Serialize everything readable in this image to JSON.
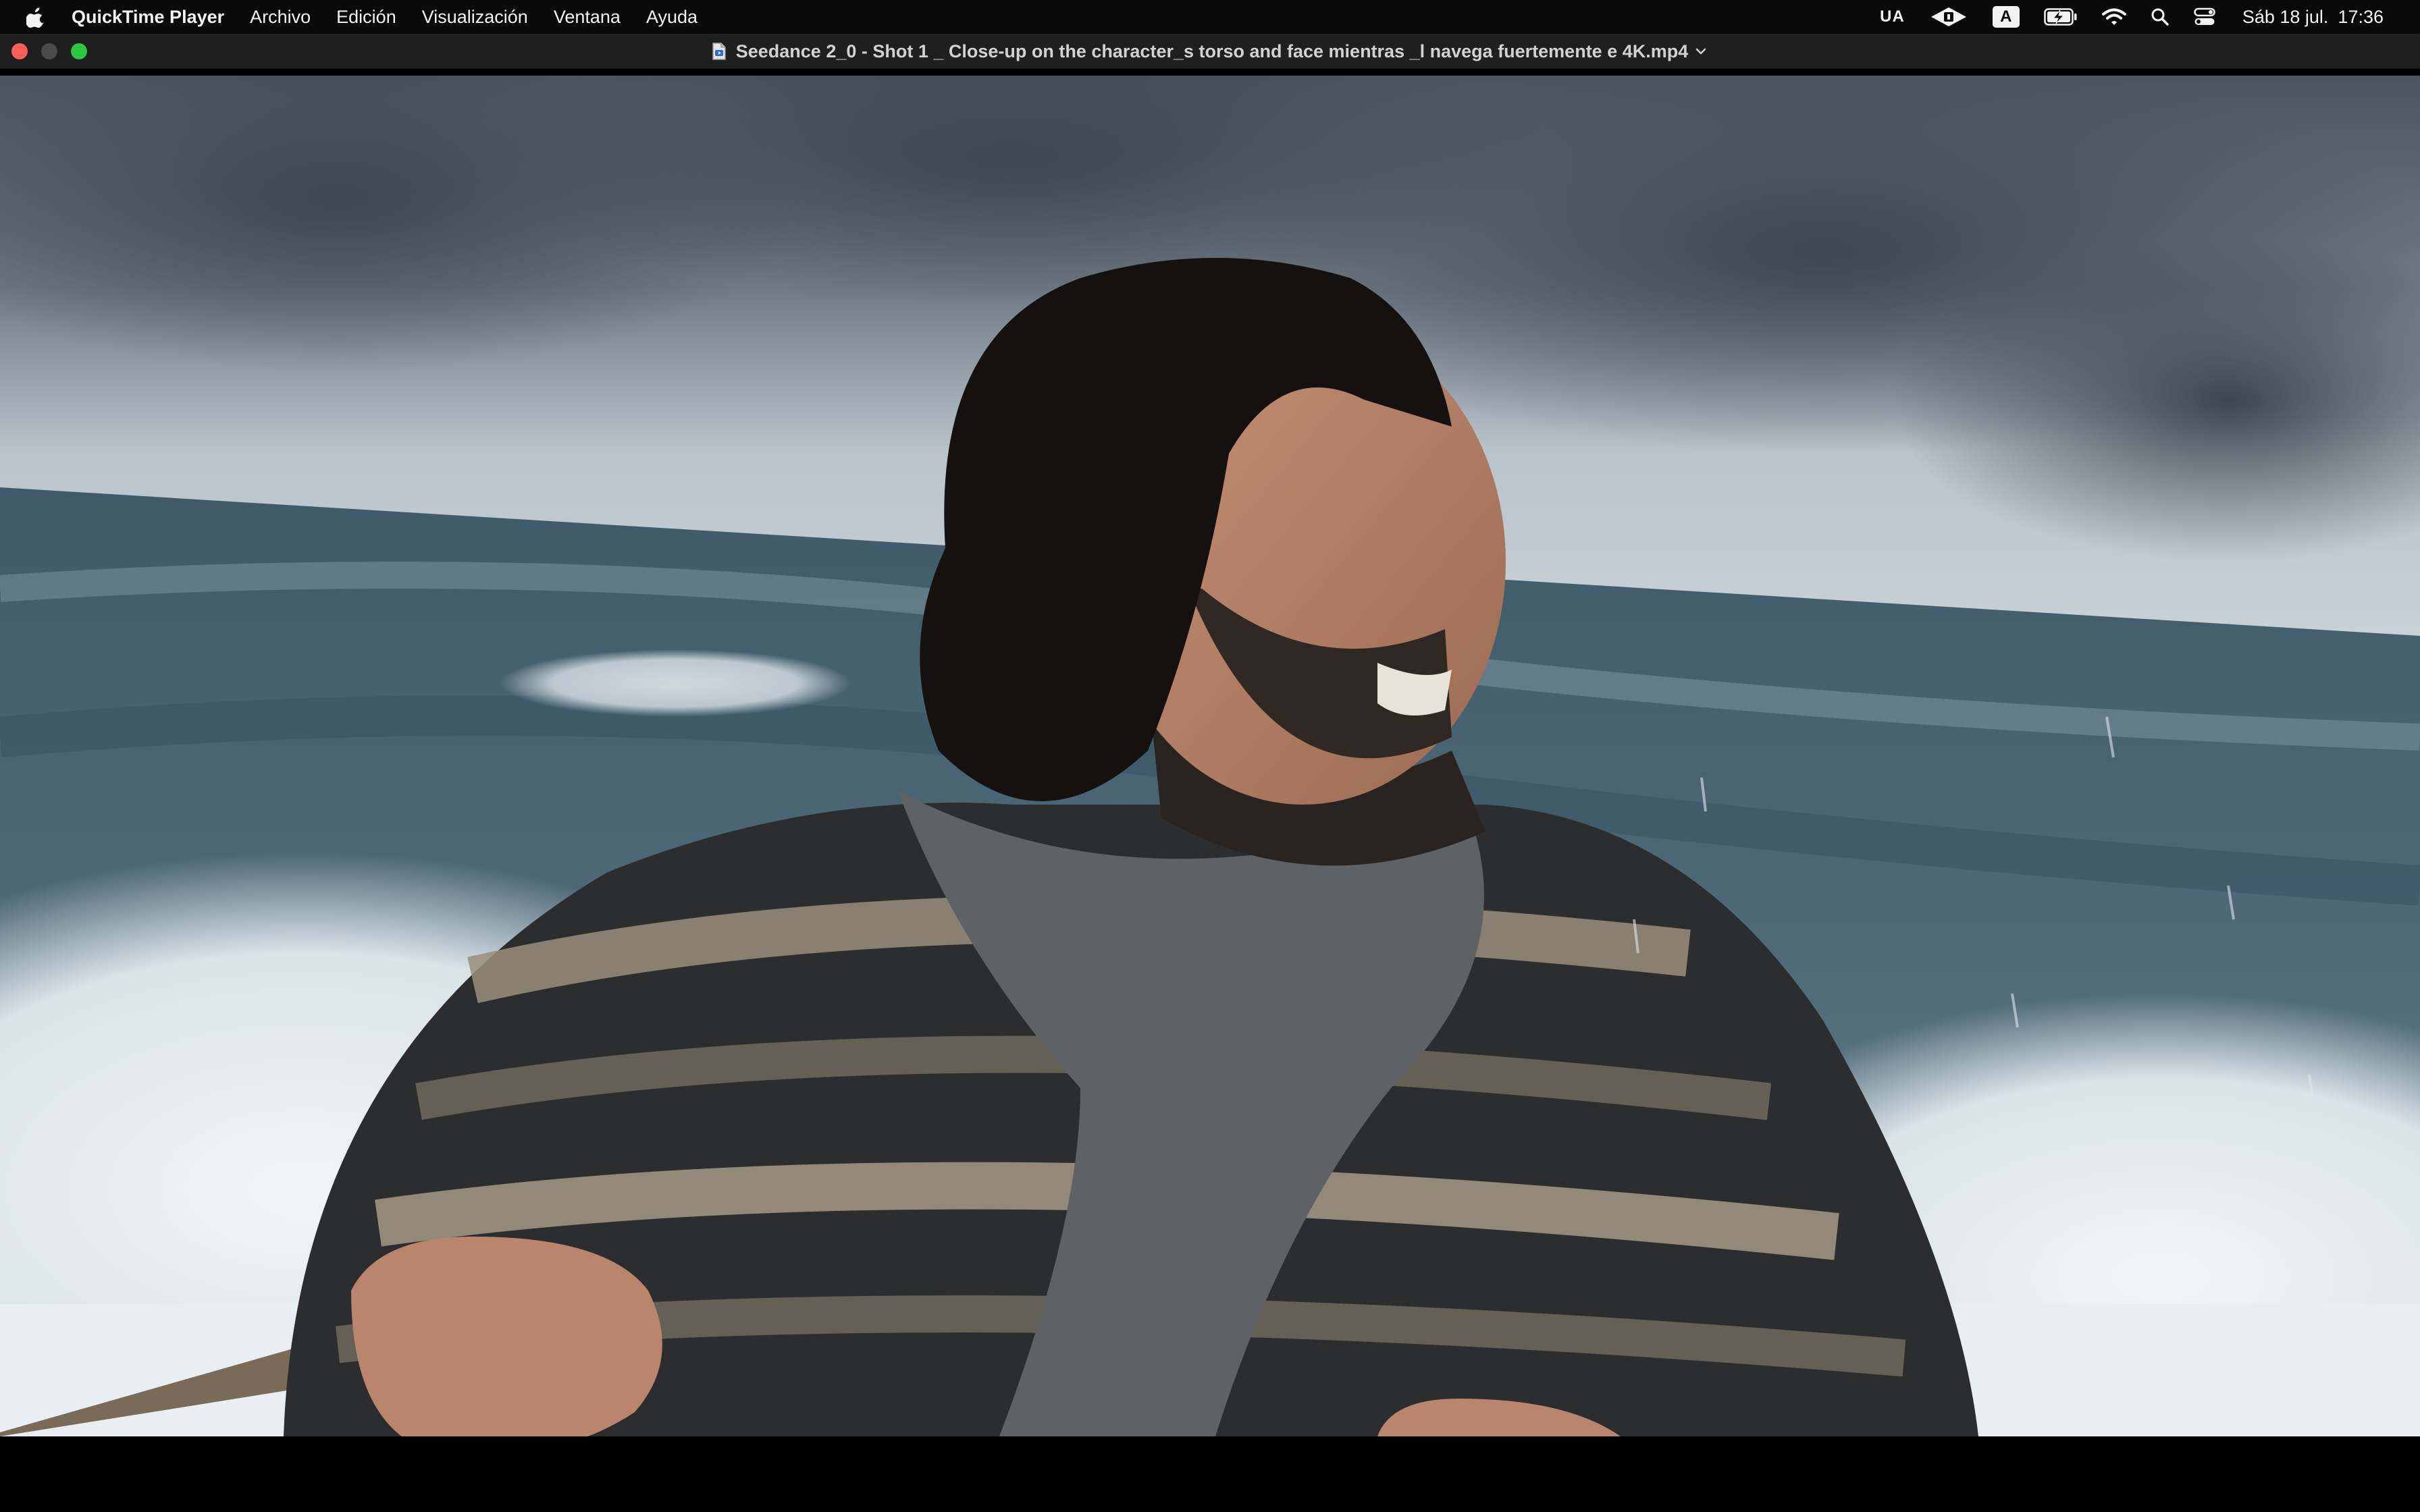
{
  "menubar": {
    "app_name": "QuickTime Player",
    "menus": [
      "Archivo",
      "Edición",
      "Visualización",
      "Ventana",
      "Ayuda"
    ],
    "status_ua": "UA",
    "keyboard_input": "A",
    "clock_day": "Sáb 18 jul.",
    "clock_time": "17:36"
  },
  "window": {
    "title": "Seedance 2_0 - Shot 1 _ Close-up on the character_s torso and face mientras  _l navega fuertemente e 4K.mp4"
  },
  "colors": {
    "close": "#fe5f57",
    "minimize": "#4b4b4b",
    "maximize": "#2ac840"
  }
}
